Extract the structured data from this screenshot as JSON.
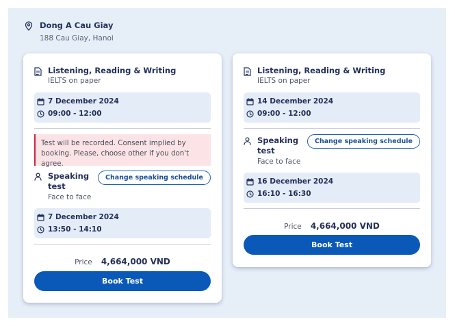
{
  "venue": {
    "name": "Dong A Cau Giay",
    "address": "188 Cau Giay, Hanoi"
  },
  "cards": [
    {
      "test_title": "Listening, Reading & Writing",
      "test_subtitle": "IELTS on paper",
      "written_date": "7 December 2024",
      "written_time": "09:00 - 12:00",
      "alert": "Test will be recorded. Consent implied by booking. Please, choose other if you don't agree.",
      "speaking_label": "Speaking test",
      "speaking_mode": "Face to face",
      "change_button": "Change speaking schedule",
      "speaking_date": "7 December 2024",
      "speaking_time": "13:50 - 14:10",
      "price_label": "Price",
      "price_value": "4,664,000 VND",
      "book_button": "Book Test"
    },
    {
      "test_title": "Listening, Reading & Writing",
      "test_subtitle": "IELTS on paper",
      "written_date": "14 December 2024",
      "written_time": "09:00 - 12:00",
      "speaking_label": "Speaking test",
      "speaking_mode": "Face to face",
      "change_button": "Change speaking schedule",
      "speaking_date": "16 December 2024",
      "speaking_time": "16:10 - 16:30",
      "price_label": "Price",
      "price_value": "4,664,000 VND",
      "book_button": "Book Test"
    }
  ],
  "icons": {
    "location": "location-pin-icon",
    "document": "document-icon",
    "calendar": "calendar-icon",
    "clock": "clock-icon",
    "person": "person-icon"
  },
  "colors": {
    "primary": "#0a59b8",
    "text": "#23305a",
    "alert_bg": "#fbe3e6",
    "alert_border": "#c8283e",
    "panel_bg": "#e6eef8"
  }
}
